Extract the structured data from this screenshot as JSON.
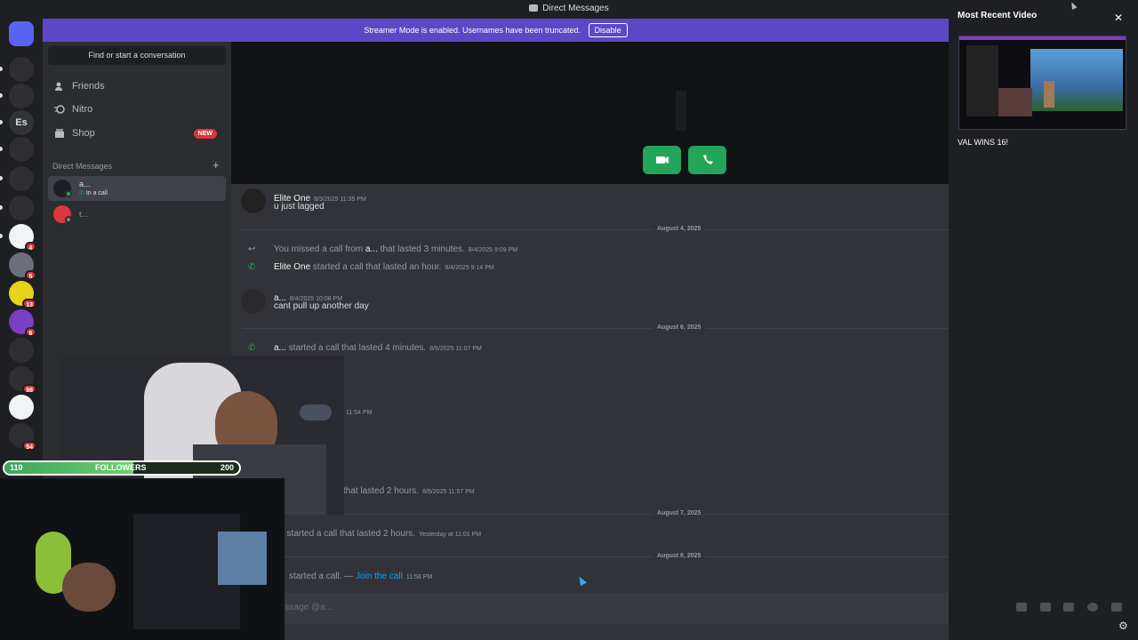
{
  "window": {
    "title": "Direct Messages"
  },
  "banner": {
    "text": "Streamer Mode is enabled. Usernames have been truncated.",
    "button": "Disable",
    "color": "#5c48c7"
  },
  "servers": [
    {
      "label": "",
      "icon": "discord-logo-icon",
      "color": "#5865f2",
      "badge": ""
    },
    {
      "label": "",
      "icon": "server-tr-icon",
      "color": "#2f2f33",
      "badge": ""
    },
    {
      "label": "",
      "icon": "server-wgs-icon",
      "color": "#2f2f33",
      "badge": ""
    },
    {
      "label": "Es",
      "icon": "",
      "color": "#313338",
      "badge": ""
    },
    {
      "label": "",
      "icon": "server-skull-icon",
      "color": "#2f2f33",
      "badge": ""
    },
    {
      "label": "",
      "icon": "server-a-icon",
      "color": "#2f2f33",
      "badge": ""
    },
    {
      "label": "",
      "icon": "server-2h-icon",
      "color": "#2f2f33",
      "badge": ""
    },
    {
      "label": "",
      "icon": "server-pinwheel-icon",
      "color": "#f2f3f5",
      "badge": "4"
    },
    {
      "label": "",
      "icon": "server-rg-icon",
      "color": "#6d6f78",
      "badge": "5"
    },
    {
      "label": "",
      "icon": "server-checker-icon",
      "color": "#e7d31b",
      "badge": "13"
    },
    {
      "label": "",
      "icon": "server-purple-icon",
      "color": "#7a3fc2",
      "badge": "6"
    },
    {
      "label": "",
      "icon": "server-e-icon",
      "color": "#2f2f33",
      "badge": ""
    },
    {
      "label": "",
      "icon": "server-car-icon",
      "color": "#2f2f33",
      "badge": "98"
    },
    {
      "label": "",
      "icon": "server-web-icon",
      "color": "#f2f3f5",
      "badge": ""
    },
    {
      "label": "",
      "icon": "server-tent-icon",
      "color": "#2f2f33",
      "badge": "54"
    }
  ],
  "sidebar": {
    "find": "Find or start a conversation",
    "nav": [
      {
        "label": "Friends",
        "icon": "friends-icon",
        "badge": ""
      },
      {
        "label": "Nitro",
        "icon": "nitro-icon",
        "badge": ""
      },
      {
        "label": "Shop",
        "icon": "shop-icon",
        "badge": "NEW"
      }
    ],
    "dm_header": "Direct Messages",
    "dms": [
      {
        "name": "a...",
        "status": "In a call"
      },
      {
        "name": "t...",
        "status": ""
      }
    ]
  },
  "chat": {
    "messages": [
      {
        "author": "Elite One",
        "time": "8/3/2025 11:35 PM",
        "text": "u just lagged"
      }
    ],
    "dividers": [
      "August 4, 2025",
      "August 6, 2025",
      "August 7, 2025",
      "August 8, 2025"
    ],
    "missed_call": {
      "pre": "You missed a call from ",
      "who": "a...",
      "post": " that lasted 3 minutes.",
      "time": "8/4/2025 9:09 PM"
    },
    "call_hour": {
      "who": "Elite One",
      "post": " started a call that lasted an hour.",
      "time": "8/4/2025 9:14 PM"
    },
    "msg_a": {
      "author": "a...",
      "time": "8/4/2025 10:08 PM",
      "text": "cant pull up another day"
    },
    "call_4min": {
      "who": "a...",
      "post": " started a call that lasted 4 minutes.",
      "time": "8/6/2025 11:07 PM"
    },
    "partial_time": "11:54 PM",
    "call_2h_a": {
      "post": "that lasted 2 hours.",
      "time": "8/6/2025 11:57 PM"
    },
    "call_2h_b": {
      "post": ". started a call that lasted 2 hours.",
      "time": "Yesterday at 11:01 PM"
    },
    "call_join": {
      "pre": "started a call. — ",
      "link": "Join the call",
      "time": "11:58 PM"
    },
    "input_placeholder": "essage @a..."
  },
  "right_panel": {
    "title": "Most Recent Video",
    "caption": "VAL WINS 16!",
    "close": "✕"
  },
  "overlay": {
    "followers_label": "FOLLOWERS",
    "followers_current": "110",
    "followers_goal": "200",
    "progress": 0.55
  }
}
